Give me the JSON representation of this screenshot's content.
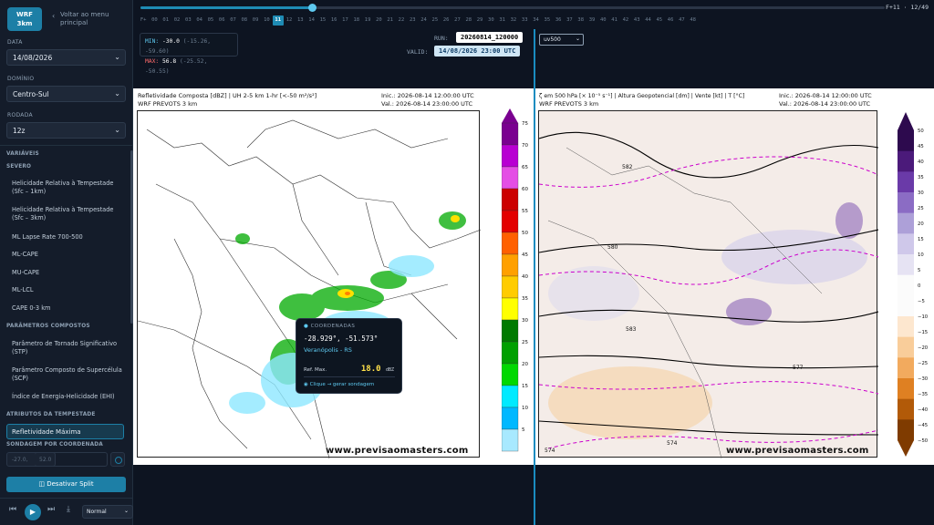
{
  "sidebar": {
    "logo": "WRF\n3km",
    "back_label": "Voltar ao menu principal",
    "data_label": "DATA",
    "data_value": "14/08/2026",
    "dominio_label": "DOMÍNIO",
    "dominio_value": "Centro-Sul",
    "rodada_label": "RODADA",
    "rodada_value": "12z",
    "variaveis_label": "VARIÁVEIS",
    "sections": [
      {
        "title": "SEVERO",
        "items": [
          "Helicidade Relativa à Tempestade (Sfc – 1km)",
          "Helicidade Relativa à Tempestade (Sfc – 3km)",
          "ML Lapse Rate 700-500",
          "ML-CAPE",
          "MU-CAPE",
          "ML-LCL",
          "CAPE 0-3 km"
        ]
      },
      {
        "title": "PARÂMETROS COMPOSTOS",
        "items": [
          "Parâmetro de Tornado Significativo (STP)",
          "Parâmetro Composto de Supercélula (SCP)",
          "Índice de Energia-Helicidade (EHI)"
        ]
      },
      {
        "title": "ATRIBUTOS DA TEMPESTADE",
        "items": [
          "Refletividade Máxima"
        ]
      }
    ],
    "sondagem_label": "SONDAGEM POR COORDENADA",
    "lat_placeholder": "-27.0,",
    "lon_placeholder": "52.0",
    "split_button": "Desativar Split",
    "playback_speed": "Normal",
    "icons": {
      "prev": "skip-back-icon",
      "play": "play-icon",
      "next": "skip-forward-icon",
      "download": "download-icon"
    }
  },
  "timeline": {
    "prefix": "F+",
    "hours": [
      "00",
      "01",
      "02",
      "03",
      "04",
      "05",
      "06",
      "07",
      "08",
      "09",
      "10",
      "11",
      "12",
      "13",
      "14",
      "15",
      "16",
      "17",
      "18",
      "19",
      "20",
      "21",
      "22",
      "23",
      "24",
      "25",
      "26",
      "27",
      "28",
      "29",
      "30",
      "31",
      "32",
      "33",
      "34",
      "35",
      "36",
      "37",
      "38",
      "39",
      "40",
      "41",
      "42",
      "43",
      "44",
      "45",
      "46",
      "47",
      "48"
    ],
    "active_hour": "11",
    "progress": 0.23,
    "counter": "F+11 · 12/49"
  },
  "info": {
    "min_label": "MIN:",
    "min_value": "-30.0",
    "min_coord": "(-15.26, -59.60)",
    "max_label": "MAX:",
    "max_value": "56.8",
    "max_coord": "(-25.52, -50.55)",
    "run_label": "RUN:",
    "run_value": "20260814_120000",
    "valid_label": "VALID:",
    "valid_value": "14/08/2026 23:00 UTC",
    "right_select": "uv500"
  },
  "left_panel": {
    "title": "Refletividade Composta [dBZ] | UH 2-5 km 1-hr [<-50 m²/s²]",
    "subtitle": "WRF PREVOTS 3 km",
    "init": "Inic.: 2026-08-14 12:00:00 UTC",
    "valid": "Val.: 2026-08-14 23:00:00 UTC",
    "watermark": "www.previsaomasters.com",
    "colorbar_ticks": [
      "75",
      "70",
      "65",
      "60",
      "55",
      "50",
      "45",
      "40",
      "35",
      "30",
      "25",
      "20",
      "15",
      "10",
      "5"
    ],
    "colorbar_colors": [
      "#7a0090",
      "#b800d2",
      "#e44ee5",
      "#cc0000",
      "#e30000",
      "#ff6000",
      "#ffa000",
      "#ffcc00",
      "#ffff00",
      "#007a00",
      "#00a000",
      "#00d800",
      "#00eaff",
      "#00b8ff",
      "#a8e9ff"
    ]
  },
  "right_panel": {
    "title": "ζ em 500 hPa [× 10⁻⁵ s⁻¹] | Altura Geopotencial [dm] | Vente [kt] | T [°C]",
    "subtitle": "WRF PREVOTS 3 km",
    "init": "Inic.: 2026-08-14 12:00:00 UTC",
    "valid": "Val.: 2026-08-14 23:00:00 UTC",
    "watermark": "www.previsaomasters.com",
    "colorbar_ticks": [
      "50",
      "45",
      "40",
      "35",
      "30",
      "25",
      "20",
      "15",
      "10",
      "5",
      "0",
      "−5",
      "−10",
      "−15",
      "−20",
      "−25",
      "−30",
      "−35",
      "−40",
      "−45",
      "−50"
    ],
    "contour_labels": [
      "582",
      "580",
      "583",
      "577",
      "574",
      "574"
    ]
  },
  "tooltip": {
    "header": "COORDENADAS",
    "coords": "-28.929°, -51.573°",
    "location": "Veranópolis - RS",
    "ref_label": "Ref. Max.",
    "ref_value": "18.0",
    "ref_unit": "dBZ",
    "link": "Clique → gerar sondagem"
  }
}
